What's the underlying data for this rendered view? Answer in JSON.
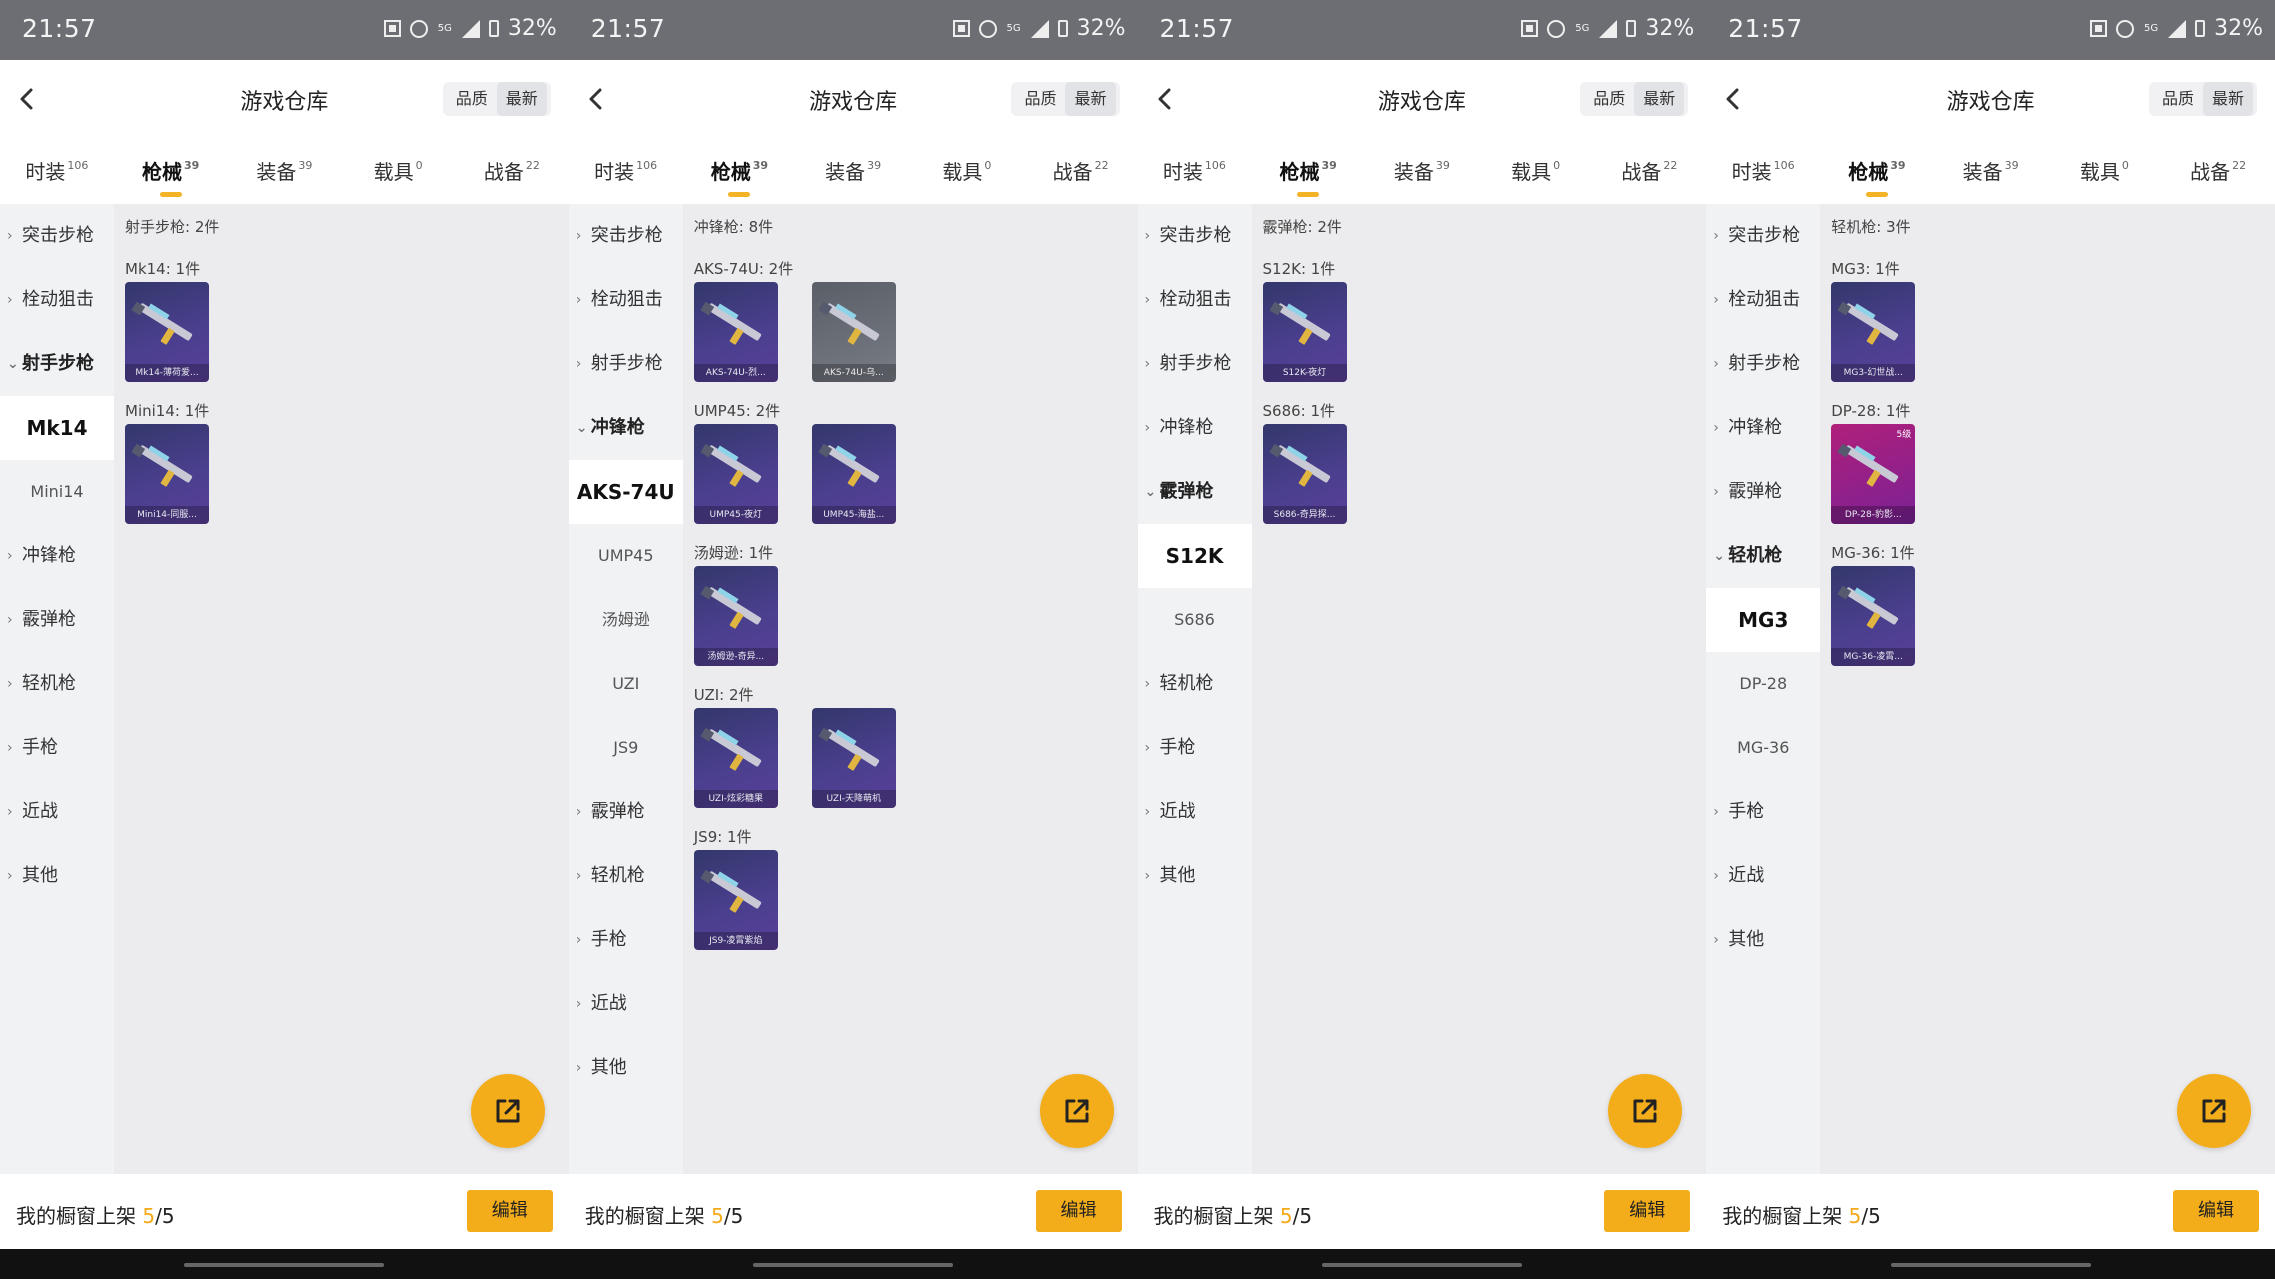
{
  "status": {
    "time": "21:57",
    "battery": "32%",
    "net": "5G"
  },
  "header": {
    "title": "游戏仓库",
    "sort_quality": "品质",
    "sort_latest": "最新"
  },
  "tabs": [
    {
      "label": "时装",
      "count": "106"
    },
    {
      "label": "枪械",
      "count": "39"
    },
    {
      "label": "装备",
      "count": "39"
    },
    {
      "label": "载具",
      "count": "0"
    },
    {
      "label": "战备",
      "count": "22"
    }
  ],
  "bottom": {
    "showcase_label": "我的橱窗上架",
    "count_current": "5",
    "count_total": "/5",
    "edit": "编辑"
  },
  "colors": {
    "accent": "#f4ad1a",
    "card": "#4a3f8e",
    "pink_card": "#b0207a"
  },
  "screens": [
    {
      "categories": [
        {
          "label": "突击步枪",
          "expanded": false
        },
        {
          "label": "栓动狙击",
          "expanded": false
        },
        {
          "label": "射手步枪",
          "expanded": true,
          "subs": [
            "Mk14",
            "Mini14"
          ],
          "active": "Mk14"
        },
        {
          "label": "冲锋枪",
          "expanded": false
        },
        {
          "label": "霰弹枪",
          "expanded": false
        },
        {
          "label": "轻机枪",
          "expanded": false
        },
        {
          "label": "手枪",
          "expanded": false
        },
        {
          "label": "近战",
          "expanded": false
        },
        {
          "label": "其他",
          "expanded": false
        }
      ],
      "group_title": "射手步枪: 2件",
      "items": [
        {
          "title": "Mk14: 1件",
          "cards": [
            {
              "label": "Mk14-薄荷爱...",
              "style": "purple"
            }
          ]
        },
        {
          "title": "Mini14: 1件",
          "cards": [
            {
              "label": "Mini14-同服...",
              "style": "purple"
            }
          ]
        }
      ]
    },
    {
      "categories": [
        {
          "label": "突击步枪",
          "expanded": false
        },
        {
          "label": "栓动狙击",
          "expanded": false
        },
        {
          "label": "射手步枪",
          "expanded": false
        },
        {
          "label": "冲锋枪",
          "expanded": true,
          "subs": [
            "AKS-74U",
            "UMP45",
            "汤姆逊",
            "UZI",
            "JS9"
          ],
          "active": "AKS-74U"
        },
        {
          "label": "霰弹枪",
          "expanded": false
        },
        {
          "label": "轻机枪",
          "expanded": false
        },
        {
          "label": "手枪",
          "expanded": false
        },
        {
          "label": "近战",
          "expanded": false
        },
        {
          "label": "其他",
          "expanded": false
        }
      ],
      "group_title": "冲锋枪: 8件",
      "items": [
        {
          "title": "AKS-74U: 2件",
          "cards": [
            {
              "label": "AKS-74U-烈...",
              "style": "purple"
            },
            {
              "label": "AKS-74U-乌...",
              "style": "gray"
            }
          ]
        },
        {
          "title": "UMP45: 2件",
          "cards": [
            {
              "label": "UMP45-夜灯",
              "style": "purple"
            },
            {
              "label": "UMP45-海盐...",
              "style": "purple"
            }
          ]
        },
        {
          "title": "汤姆逊: 1件",
          "cards": [
            {
              "label": "汤姆逊-奇异...",
              "style": "purple"
            }
          ]
        },
        {
          "title": "UZI: 2件",
          "cards": [
            {
              "label": "UZI-炫彩糖果",
              "style": "purple"
            },
            {
              "label": "UZI-天降萌机",
              "style": "purple"
            }
          ]
        },
        {
          "title": "JS9: 1件",
          "cards": [
            {
              "label": "JS9-凌霄紫焰",
              "style": "purple"
            }
          ]
        }
      ]
    },
    {
      "categories": [
        {
          "label": "突击步枪",
          "expanded": false
        },
        {
          "label": "栓动狙击",
          "expanded": false
        },
        {
          "label": "射手步枪",
          "expanded": false
        },
        {
          "label": "冲锋枪",
          "expanded": false
        },
        {
          "label": "霰弹枪",
          "expanded": true,
          "subs": [
            "S12K",
            "S686"
          ],
          "active": "S12K"
        },
        {
          "label": "轻机枪",
          "expanded": false
        },
        {
          "label": "手枪",
          "expanded": false
        },
        {
          "label": "近战",
          "expanded": false
        },
        {
          "label": "其他",
          "expanded": false
        }
      ],
      "group_title": "霰弹枪: 2件",
      "items": [
        {
          "title": "S12K: 1件",
          "cards": [
            {
              "label": "S12K-夜灯",
              "style": "purple"
            }
          ]
        },
        {
          "title": "S686: 1件",
          "cards": [
            {
              "label": "S686-奇异探...",
              "style": "purple"
            }
          ]
        }
      ]
    },
    {
      "categories": [
        {
          "label": "突击步枪",
          "expanded": false
        },
        {
          "label": "栓动狙击",
          "expanded": false
        },
        {
          "label": "射手步枪",
          "expanded": false
        },
        {
          "label": "冲锋枪",
          "expanded": false
        },
        {
          "label": "霰弹枪",
          "expanded": false
        },
        {
          "label": "轻机枪",
          "expanded": true,
          "subs": [
            "MG3",
            "DP-28",
            "MG-36"
          ],
          "active": "MG3"
        },
        {
          "label": "手枪",
          "expanded": false
        },
        {
          "label": "近战",
          "expanded": false
        },
        {
          "label": "其他",
          "expanded": false
        }
      ],
      "group_title": "轻机枪: 3件",
      "items": [
        {
          "title": "MG3: 1件",
          "cards": [
            {
              "label": "MG3-幻世战...",
              "style": "purple"
            }
          ]
        },
        {
          "title": "DP-28: 1件",
          "cards": [
            {
              "label": "DP-28-豹影...",
              "style": "pink",
              "badge": "5级"
            }
          ]
        },
        {
          "title": "MG-36: 1件",
          "cards": [
            {
              "label": "MG-36-凌霄...",
              "style": "purple"
            }
          ]
        }
      ]
    }
  ]
}
